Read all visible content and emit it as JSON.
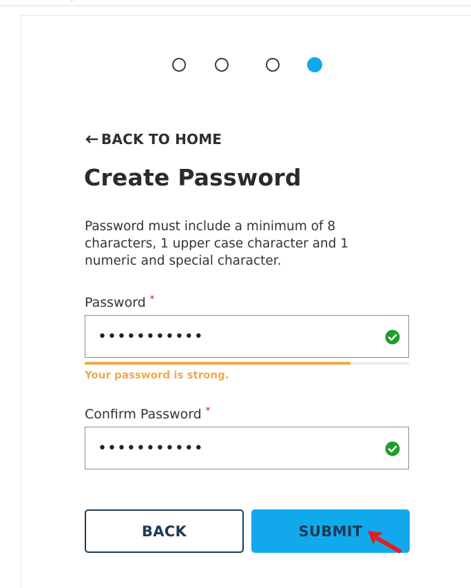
{
  "stepper": {
    "total_steps": 4,
    "current_step": 4,
    "accent_color": "#12a9ec"
  },
  "nav": {
    "back_home_label": "BACK TO HOME",
    "back_icon": "left-arrow-icon"
  },
  "page": {
    "title": "Create Password",
    "hint": "Password must include a minimum of 8 characters, 1 upper case character and 1 numeric and special character."
  },
  "form": {
    "password": {
      "label": "Password",
      "required_mark": "*",
      "value": "•••••••••••",
      "valid_icon": "check-circle-icon"
    },
    "strength": {
      "level_fraction": 0.82,
      "message": "Your password is strong.",
      "color": "#f0a94a"
    },
    "confirm_password": {
      "label": "Confirm Password",
      "required_mark": "*",
      "value": "•••••••••••",
      "valid_icon": "check-circle-icon"
    }
  },
  "actions": {
    "back_label": "BACK",
    "submit_label": "SUBMIT"
  },
  "colors": {
    "valid_green": "#1e9e2a",
    "required_red": "#d0021b",
    "button_dark": "#1e3a55"
  }
}
